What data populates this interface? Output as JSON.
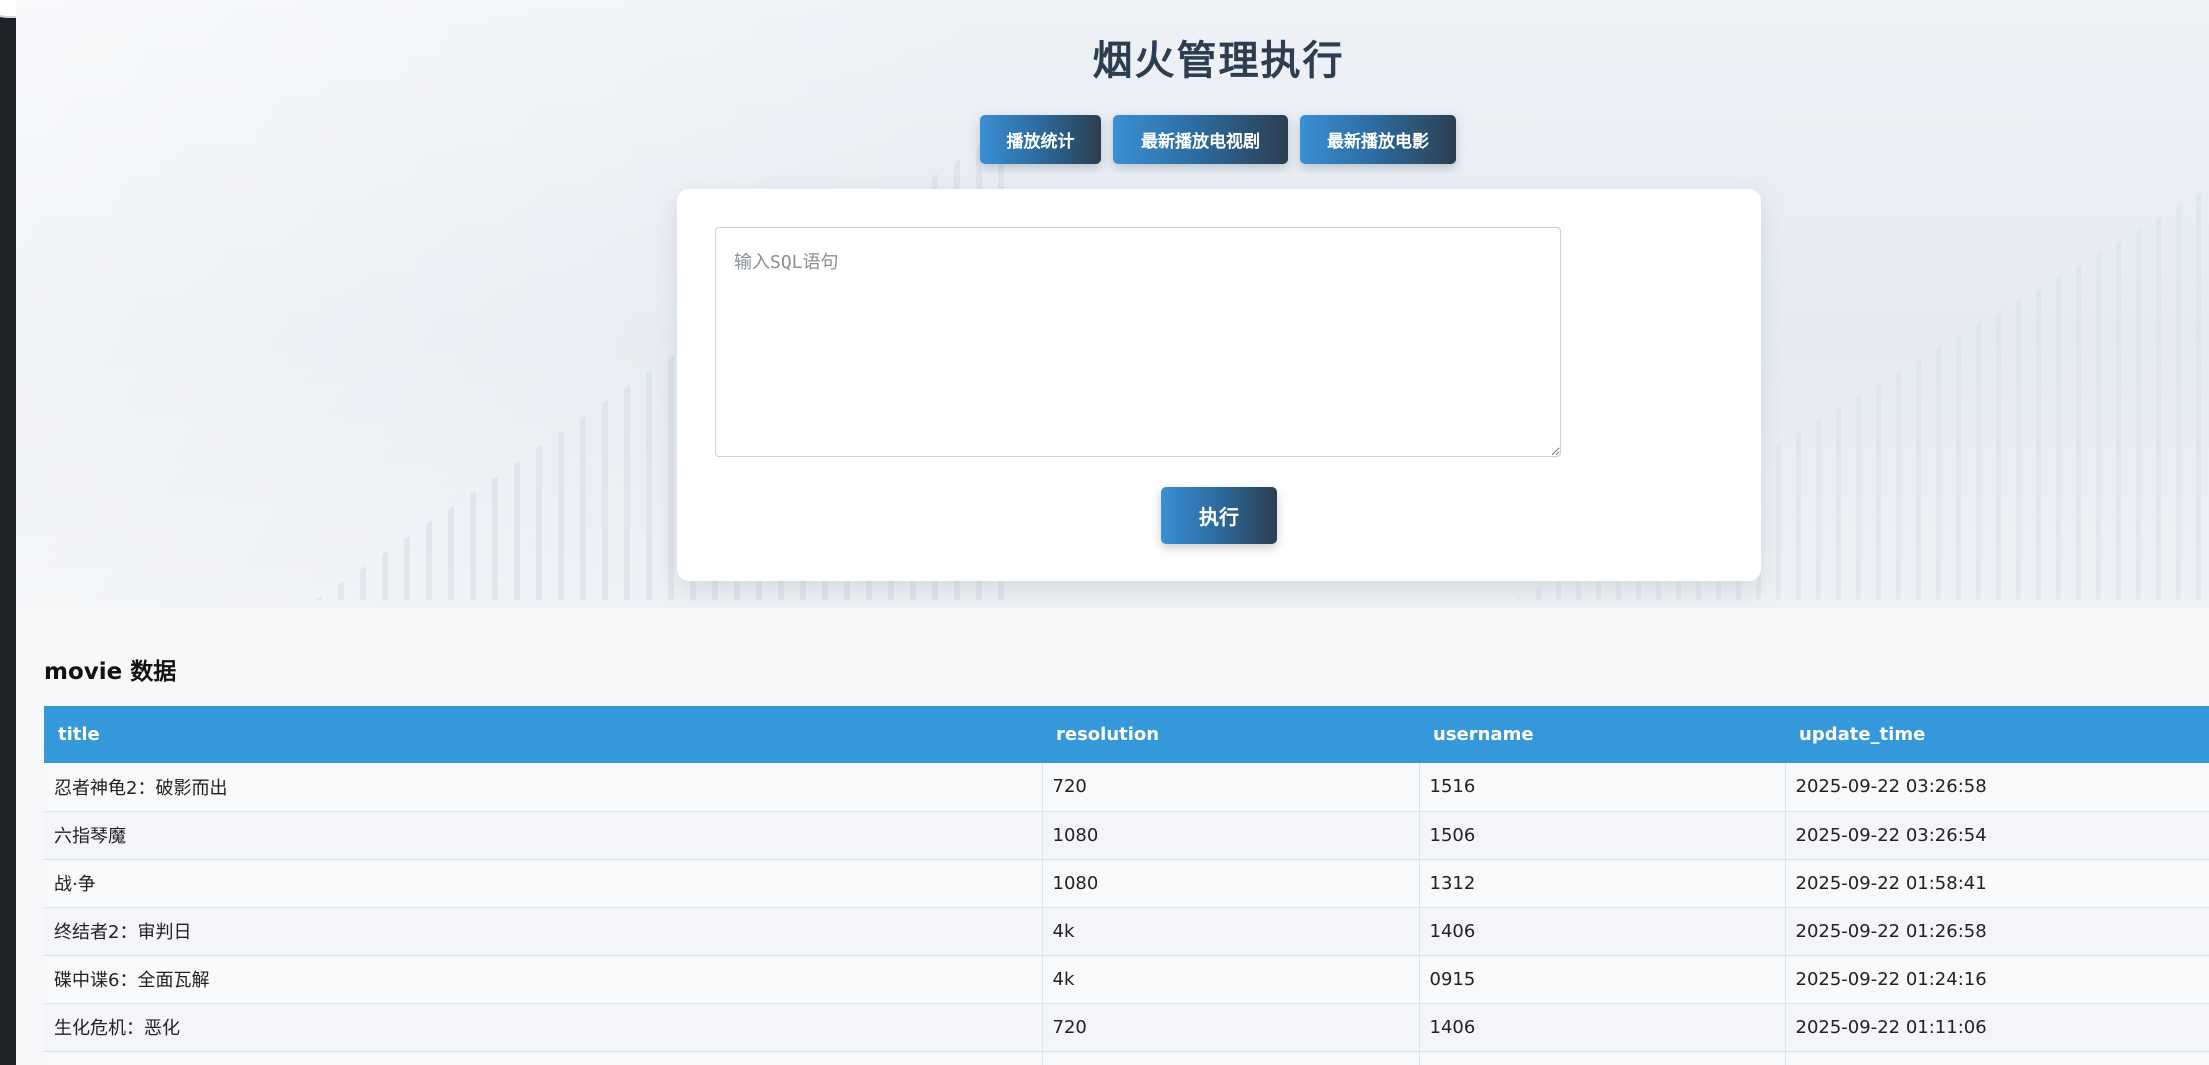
{
  "header": {
    "title": "烟火管理执行"
  },
  "nav": {
    "buttons": [
      {
        "label": "播放统计"
      },
      {
        "label": "最新播放电视剧"
      },
      {
        "label": "最新播放电影"
      }
    ]
  },
  "query": {
    "placeholder": "输入SQL语句",
    "value": "",
    "execute_label": "执行"
  },
  "results": {
    "title": "movie 数据",
    "columns": [
      "title",
      "resolution",
      "username",
      "update_time"
    ],
    "rows": [
      [
        "忍者神龟2：破影而出",
        "720",
        "1516",
        "2025-09-22 03:26:58"
      ],
      [
        "六指琴魔",
        "1080",
        "1506",
        "2025-09-22 03:26:54"
      ],
      [
        "战·争",
        "1080",
        "1312",
        "2025-09-22 01:58:41"
      ],
      [
        "终结者2：审判日",
        "4k",
        "1406",
        "2025-09-22 01:26:58"
      ],
      [
        "碟中谍6：全面瓦解",
        "4k",
        "0915",
        "2025-09-22 01:24:16"
      ],
      [
        "生化危机：恶化",
        "720",
        "1406",
        "2025-09-22 01:11:06"
      ]
    ]
  },
  "colors": {
    "accent": "#3498db",
    "button_start": "#3a8fd4",
    "button_end": "#2c3e50",
    "title": "#2d3e50"
  }
}
